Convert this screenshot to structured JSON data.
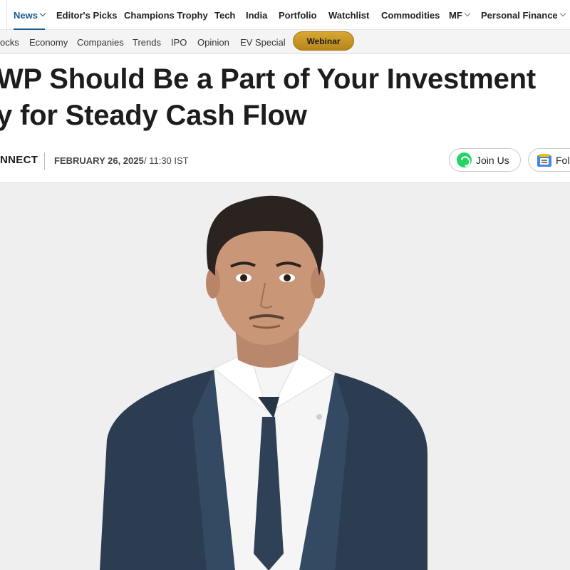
{
  "topnav": {
    "items": [
      {
        "label": "News",
        "active": true,
        "dropdown": true
      },
      {
        "label": "Editor's Picks"
      },
      {
        "label": "Champions Trophy"
      },
      {
        "label": "Tech"
      },
      {
        "label": "India"
      },
      {
        "label": "Portfolio"
      },
      {
        "label": "Watchlist"
      },
      {
        "label": "Commodities"
      },
      {
        "label": "MF",
        "dropdown": true
      },
      {
        "label": "Personal Finance",
        "dropdown": true
      }
    ]
  },
  "subnav": {
    "items": [
      "ocks",
      "Economy",
      "Companies",
      "Trends",
      "IPO",
      "Opinion",
      "EV Special"
    ],
    "webinar_label": "Webinar"
  },
  "article": {
    "headline_line1": "WP Should Be a Part of Your Investment",
    "headline_line2": "y for Steady Cash Flow",
    "author": "NNECT",
    "date": "FEBRUARY 26, 2025",
    "time": "/ 11:30 IST",
    "join_label": "Join Us",
    "follow_label": "Fol"
  },
  "hero_image": {
    "icon": "person-portrait-photo"
  },
  "colors": {
    "accent": "#1a5c8e",
    "webinar": "#c99a26",
    "whatsapp": "#25d366"
  }
}
